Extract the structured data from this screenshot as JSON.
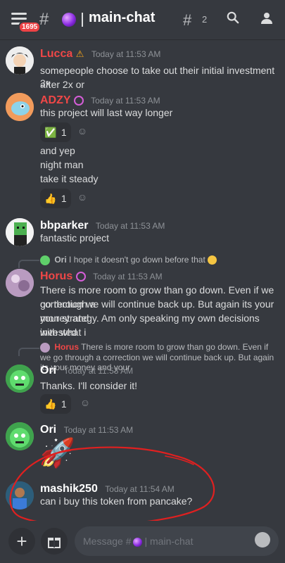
{
  "header": {
    "badge_count": "1695",
    "channel_name": "main-chat",
    "threads_count": "2"
  },
  "messages": [
    {
      "user": "Lucca",
      "name_color": "#f04747",
      "badge": "⚠",
      "time": "Today at 11:53 AM",
      "lines": [
        "somepeople choose to take out their initial investment after 2x or",
        "3x"
      ]
    },
    {
      "user": "ADZY",
      "name_color": "#f04747",
      "time": "Today at 11:53 AM",
      "lines": [
        "this project will last way longer"
      ],
      "reaction1": {
        "emoji": "✅",
        "count": "1"
      },
      "lines2": [
        "and yep",
        "night man",
        "take it steady"
      ],
      "reaction2": {
        "emoji": "👍",
        "count": "1"
      }
    },
    {
      "user": "bbparker",
      "name_color": "#ffffff",
      "time": "Today at 11:53 AM",
      "lines": [
        "fantastic project"
      ]
    },
    {
      "reply_to": {
        "user": "Ori",
        "text": "I hope it doesn't go down before that"
      },
      "user": "Horus",
      "name_color": "#f04747",
      "time": "Today at 11:53 AM",
      "lines": [
        "There is more room to grow than go down. Even if we go through a",
        "correction we will continue back up. But again its your money and",
        "your strategy. Am only speaking my own decisions with what i",
        "invested"
      ]
    },
    {
      "reply_to": {
        "user": "Horus",
        "text": "There is more room to grow than go down. Even if we go through a correction we will continue back up. But again its your money and your"
      },
      "user": "Ori",
      "name_color": "#ffffff",
      "time": "Today at 11:53 AM",
      "lines": [
        "Thanks. I'll consider it!"
      ],
      "reaction": {
        "emoji": "👍",
        "count": "1"
      }
    },
    {
      "user": "Ori",
      "name_color": "#ffffff",
      "time": "Today at 11:53 AM",
      "emoji": "🚀"
    },
    {
      "user": "mashik250",
      "name_color": "#ffffff",
      "time": "Today at 11:54 AM",
      "lines": [
        "can i buy this token from pancake?"
      ]
    }
  ],
  "composer": {
    "placeholder_prefix": "Message #",
    "placeholder_channel": "| main-chat"
  },
  "icons": [
    "menu-icon",
    "hash-icon",
    "threads-icon",
    "search-icon",
    "members-icon",
    "plus-icon",
    "gift-icon",
    "emoji-icon",
    "add-reaction-icon"
  ]
}
